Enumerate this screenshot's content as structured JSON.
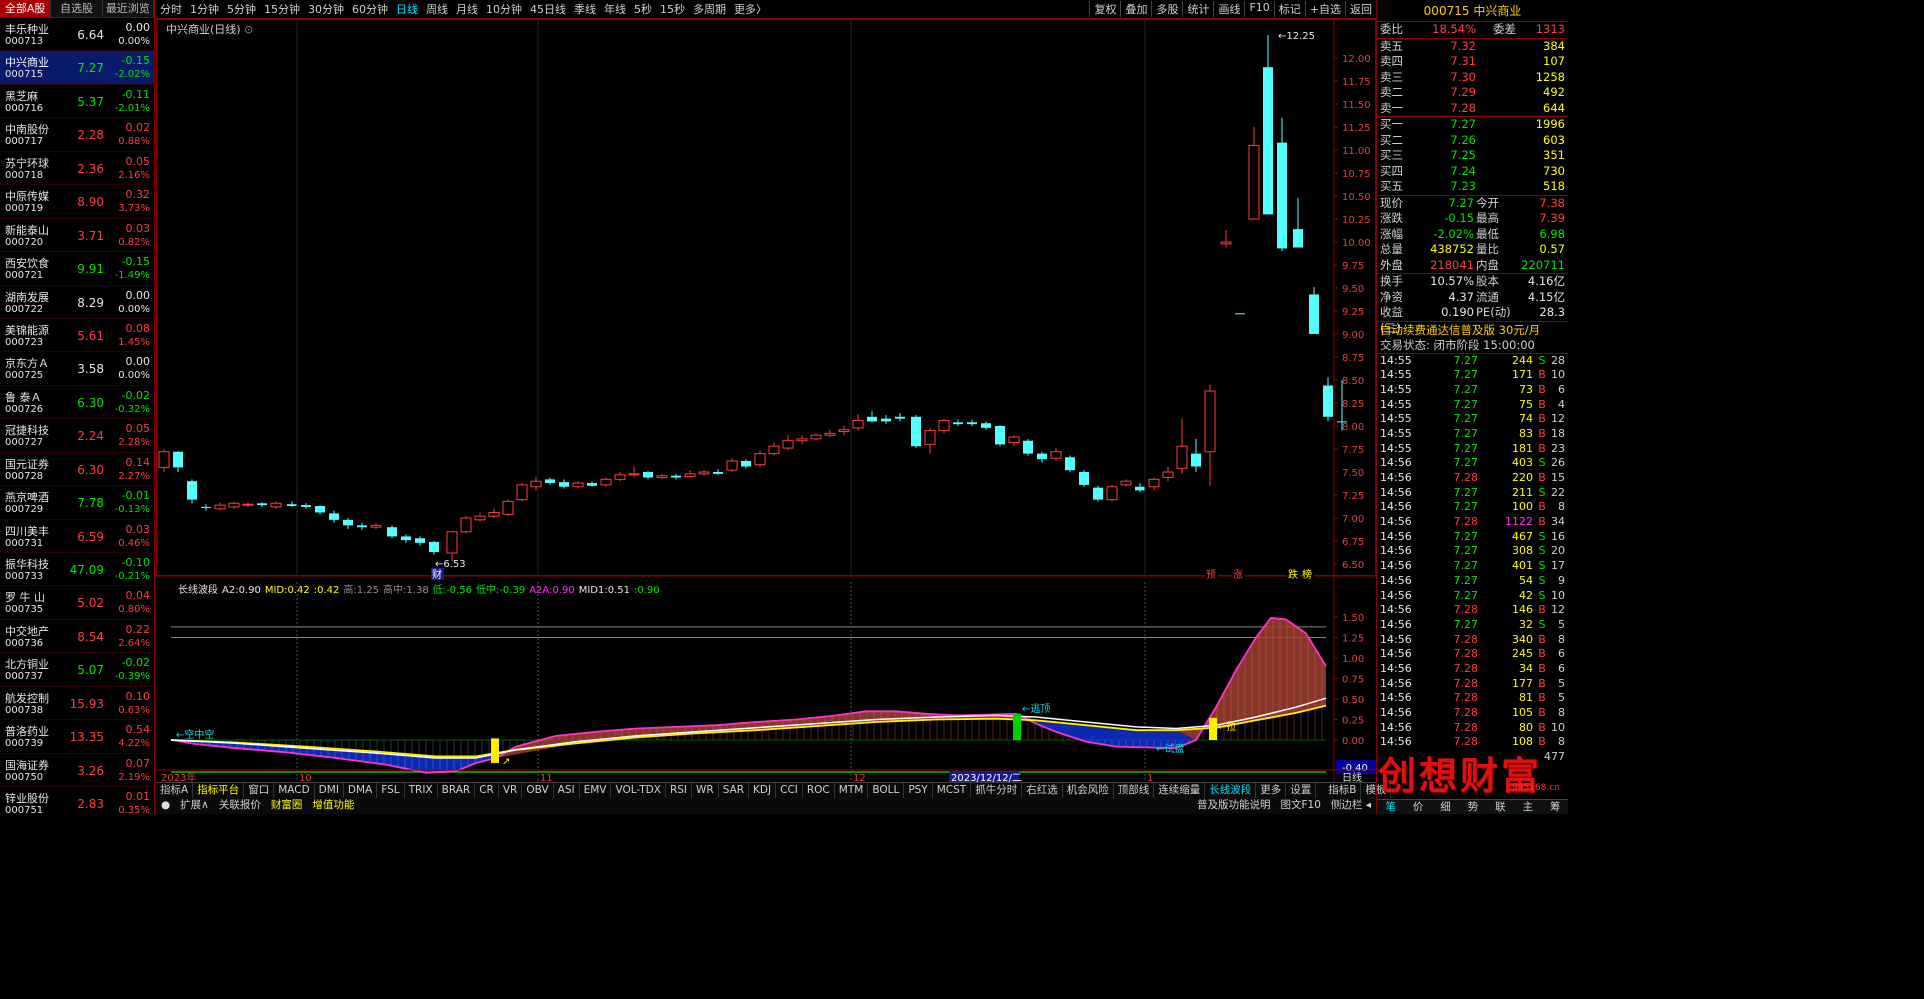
{
  "left_tabs": [
    "全部A股",
    "自选股",
    "最近浏览"
  ],
  "stocks": [
    {
      "name": "丰乐种业",
      "code": "000713",
      "price": "6.64",
      "chg": "0.00",
      "pct": "0.00%",
      "dir": "flat"
    },
    {
      "name": "中兴商业",
      "code": "000715",
      "price": "7.27",
      "chg": "-0.15",
      "pct": "-2.02%",
      "dir": "down",
      "sel": true
    },
    {
      "name": "黑芝麻",
      "code": "000716",
      "price": "5.37",
      "chg": "-0.11",
      "pct": "-2.01%",
      "dir": "down"
    },
    {
      "name": "中南股份",
      "code": "000717",
      "price": "2.28",
      "chg": "0.02",
      "pct": "0.88%",
      "dir": "up"
    },
    {
      "name": "苏宁环球",
      "code": "000718",
      "price": "2.36",
      "chg": "0.05",
      "pct": "2.16%",
      "dir": "up"
    },
    {
      "name": "中原传媒",
      "code": "000719",
      "price": "8.90",
      "chg": "0.32",
      "pct": "3.73%",
      "dir": "up"
    },
    {
      "name": "新能泰山",
      "code": "000720",
      "price": "3.71",
      "chg": "0.03",
      "pct": "0.82%",
      "dir": "up"
    },
    {
      "name": "西安饮食",
      "code": "000721",
      "price": "9.91",
      "chg": "-0.15",
      "pct": "-1.49%",
      "dir": "down"
    },
    {
      "name": "湖南发展",
      "code": "000722",
      "price": "8.29",
      "chg": "0.00",
      "pct": "0.00%",
      "dir": "flat"
    },
    {
      "name": "美锦能源",
      "code": "000723",
      "price": "5.61",
      "chg": "0.08",
      "pct": "1.45%",
      "dir": "up"
    },
    {
      "name": "京东方Ａ",
      "code": "000725",
      "price": "3.58",
      "chg": "0.00",
      "pct": "0.00%",
      "dir": "flat"
    },
    {
      "name": "鲁 泰Ａ",
      "code": "000726",
      "price": "6.30",
      "chg": "-0.02",
      "pct": "-0.32%",
      "dir": "down"
    },
    {
      "name": "冠捷科技",
      "code": "000727",
      "price": "2.24",
      "chg": "0.05",
      "pct": "2.28%",
      "dir": "up"
    },
    {
      "name": "国元证券",
      "code": "000728",
      "price": "6.30",
      "chg": "0.14",
      "pct": "2.27%",
      "dir": "up"
    },
    {
      "name": "燕京啤酒",
      "code": "000729",
      "price": "7.78",
      "chg": "-0.01",
      "pct": "-0.13%",
      "dir": "down"
    },
    {
      "name": "四川美丰",
      "code": "000731",
      "price": "6.59",
      "chg": "0.03",
      "pct": "0.46%",
      "dir": "up"
    },
    {
      "name": "振华科技",
      "code": "000733",
      "price": "47.09",
      "chg": "-0.10",
      "pct": "-0.21%",
      "dir": "down"
    },
    {
      "name": "罗 牛 山",
      "code": "000735",
      "price": "5.02",
      "chg": "0.04",
      "pct": "0.80%",
      "dir": "up"
    },
    {
      "name": "中交地产",
      "code": "000736",
      "price": "8.54",
      "chg": "0.22",
      "pct": "2.64%",
      "dir": "up"
    },
    {
      "name": "北方铜业",
      "code": "000737",
      "price": "5.07",
      "chg": "-0.02",
      "pct": "-0.39%",
      "dir": "down"
    },
    {
      "name": "航发控制",
      "code": "000738",
      "price": "15.93",
      "chg": "0.10",
      "pct": "0.63%",
      "dir": "up"
    },
    {
      "name": "普洛药业",
      "code": "000739",
      "price": "13.35",
      "chg": "0.54",
      "pct": "4.22%",
      "dir": "up"
    },
    {
      "name": "国海证券",
      "code": "000750",
      "price": "3.26",
      "chg": "0.07",
      "pct": "2.19%",
      "dir": "up"
    },
    {
      "name": "锌业股份",
      "code": "000751",
      "price": "2.83",
      "chg": "0.01",
      "pct": "0.35%",
      "dir": "up"
    }
  ],
  "periods": [
    "分时",
    "1分钟",
    "5分钟",
    "15分钟",
    "30分钟",
    "60分钟",
    "日线",
    "周线",
    "月线",
    "10分钟",
    "45日线",
    "季线",
    "年线",
    "5秒",
    "15秒",
    "多周期",
    "更多〉"
  ],
  "active_period": "日线",
  "tools": [
    "复权",
    "叠加",
    "多股",
    "统计",
    "画线",
    "F10",
    "标记",
    "+自选",
    "返回"
  ],
  "chart_title": "中兴商业(日线)",
  "price_axis": [
    "12.00",
    "11.75",
    "11.50",
    "11.25",
    "11.00",
    "10.75",
    "10.50",
    "10.25",
    "10.00",
    "9.75",
    "9.50",
    "9.25",
    "9.00",
    "8.75",
    "8.50",
    "8.25",
    "8.00",
    "7.75",
    "7.50",
    "7.25",
    "7.00",
    "6.75",
    "6.50"
  ],
  "high_label": "12.25",
  "low_label": "6.53",
  "markers": {
    "cai": "财",
    "yu": "预",
    "zhang": "涨",
    "die": "跌",
    "bang": "榜"
  },
  "indicator": {
    "name": "长线波段",
    "params": [
      [
        "A2:",
        "0.90",
        "wht"
      ],
      [
        "MID:",
        "0.42",
        "yel"
      ],
      [
        ":",
        "0.42",
        "yel"
      ],
      [
        "高:",
        "1.25",
        "grey"
      ],
      [
        "高中:",
        "1.38",
        "grey"
      ],
      [
        "低:",
        "-0.56",
        "grn"
      ],
      [
        "低中:",
        "-0.39",
        "grn"
      ],
      [
        "A2A:",
        "0.90",
        "mag"
      ],
      [
        "MID1:",
        "0.51",
        "wht"
      ],
      [
        ":",
        "0.90",
        "grn"
      ]
    ],
    "axis": [
      "1.50",
      "1.25",
      "1.00",
      "0.75",
      "0.50",
      "0.25",
      "0.00"
    ],
    "value_box": "-0.40",
    "labels": {
      "l1": "空中空",
      "l2": "逃顶",
      "l3": "试盘",
      "l4": "拉"
    }
  },
  "date_axis": [
    "2023年",
    "10",
    "11",
    "12",
    "2023/12/12/二",
    "1"
  ],
  "period_label": "日线",
  "bottom_tabs": [
    "指标A",
    "指标平台",
    "窗口",
    "MACD",
    "DMI",
    "DMA",
    "FSL",
    "TRIX",
    "BRAR",
    "CR",
    "VR",
    "OBV",
    "ASI",
    "EMV",
    "VOL-TDX",
    "RSI",
    "WR",
    "SAR",
    "KDJ",
    "CCI",
    "ROC",
    "MTM",
    "BOLL",
    "PSY",
    "MCST",
    "抓牛分时",
    "右红选",
    "机会风险",
    "顶部线",
    "连续缩量",
    "长线波段",
    "更多",
    "设置"
  ],
  "bottom_right_tabs": [
    "指标B",
    "模板"
  ],
  "bottom_tabs2": [
    "扩展∧",
    "关联报价",
    "财富圈",
    "增值功能"
  ],
  "bottom_tabs2_right": [
    "普及版功能说明",
    "图文F10",
    "侧边栏 ◂"
  ],
  "quote": {
    "code": "000715",
    "name": "中兴商业",
    "weibi": "18.54%",
    "weicha": "1313",
    "sells": [
      [
        "卖五",
        "7.32",
        "384"
      ],
      [
        "卖四",
        "7.31",
        "107"
      ],
      [
        "卖三",
        "7.30",
        "1258"
      ],
      [
        "卖二",
        "7.29",
        "492"
      ],
      [
        "卖一",
        "7.28",
        "644"
      ]
    ],
    "buys": [
      [
        "买一",
        "7.27",
        "1996"
      ],
      [
        "买二",
        "7.26",
        "603"
      ],
      [
        "买三",
        "7.25",
        "351"
      ],
      [
        "买四",
        "7.24",
        "730"
      ],
      [
        "买五",
        "7.23",
        "518"
      ]
    ],
    "rows": [
      [
        [
          "现价",
          "7.27",
          "grn"
        ],
        [
          "今开",
          "7.38",
          "red"
        ]
      ],
      [
        [
          "涨跌",
          "-0.15",
          "grn"
        ],
        [
          "最高",
          "7.39",
          "red"
        ]
      ],
      [
        [
          "涨幅",
          "-2.02%",
          "grn"
        ],
        [
          "最低",
          "6.98",
          "grn"
        ]
      ],
      [
        [
          "总量",
          "438752",
          "yel"
        ],
        [
          "量比",
          "0.57",
          "yel"
        ]
      ],
      [
        [
          "外盘",
          "218041",
          "red"
        ],
        [
          "内盘",
          "220711",
          "grn"
        ]
      ]
    ],
    "rows2": [
      [
        [
          "换手",
          "10.57%",
          "wht"
        ],
        [
          "股本",
          "4.16亿",
          "wht"
        ]
      ],
      [
        [
          "净资",
          "4.37",
          "wht"
        ],
        [
          "流通",
          "4.15亿",
          "wht"
        ]
      ],
      [
        [
          "收益(三)",
          "0.190",
          "wht"
        ],
        [
          "PE(动)",
          "28.3",
          "wht"
        ]
      ]
    ],
    "ad": "自动续费通达信普及版  30元/月",
    "status": "交易状态: 闭市阶段 15:00:00",
    "ticks": [
      [
        "14:55",
        "7.27",
        "244",
        "S",
        "28"
      ],
      [
        "14:55",
        "7.27",
        "171",
        "B",
        "10"
      ],
      [
        "14:55",
        "7.27",
        "73",
        "B",
        "6"
      ],
      [
        "14:55",
        "7.27",
        "75",
        "B",
        "4"
      ],
      [
        "14:55",
        "7.27",
        "74",
        "B",
        "12"
      ],
      [
        "14:55",
        "7.27",
        "83",
        "B",
        "18"
      ],
      [
        "14:55",
        "7.27",
        "181",
        "B",
        "23"
      ],
      [
        "14:56",
        "7.27",
        "403",
        "S",
        "26"
      ],
      [
        "14:56",
        "7.28",
        "220",
        "B",
        "15"
      ],
      [
        "14:56",
        "7.27",
        "211",
        "S",
        "22"
      ],
      [
        "14:56",
        "7.27",
        "100",
        "B",
        "8"
      ],
      [
        "14:56",
        "7.28",
        "1122",
        "B",
        "34"
      ],
      [
        "14:56",
        "7.27",
        "467",
        "S",
        "16"
      ],
      [
        "14:56",
        "7.27",
        "308",
        "S",
        "20"
      ],
      [
        "14:56",
        "7.27",
        "401",
        "S",
        "17"
      ],
      [
        "14:56",
        "7.27",
        "54",
        "S",
        "9"
      ],
      [
        "14:56",
        "7.27",
        "42",
        "S",
        "10"
      ],
      [
        "14:56",
        "7.28",
        "146",
        "B",
        "12"
      ],
      [
        "14:56",
        "7.27",
        "32",
        "S",
        "5"
      ],
      [
        "14:56",
        "7.28",
        "340",
        "B",
        "8"
      ],
      [
        "14:56",
        "7.28",
        "245",
        "B",
        "6"
      ],
      [
        "14:56",
        "7.28",
        "34",
        "B",
        "6"
      ],
      [
        "14:56",
        "7.28",
        "177",
        "B",
        "5"
      ],
      [
        "14:56",
        "7.28",
        "81",
        "B",
        "5"
      ],
      [
        "14:56",
        "7.28",
        "105",
        "B",
        "8"
      ],
      [
        "14:56",
        "7.28",
        "80",
        "B",
        "10"
      ],
      [
        "14:56",
        "7.28",
        "108",
        "B",
        "8"
      ],
      [
        "",
        "",
        "",
        "",
        "477"
      ]
    ],
    "tabs": [
      "笔",
      "价",
      "细",
      "势",
      "联",
      "主",
      "筹"
    ]
  },
  "watermark": "创想财富",
  "watermark_url": "995168.cn"
}
